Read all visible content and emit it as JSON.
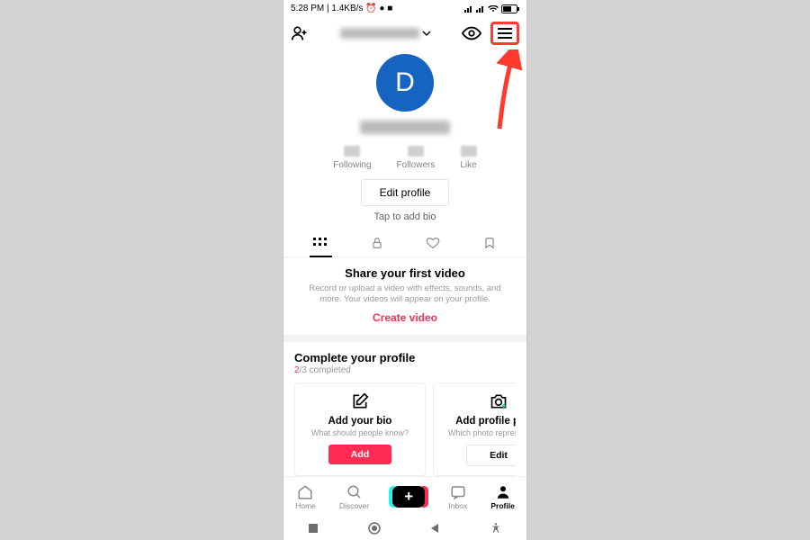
{
  "statusbar": {
    "left": "5:28 PM | 1.4KB/s ⏰ ● ■",
    "right": ""
  },
  "header": {
    "username_blurred": "████████ ████",
    "avatar_letter": "D"
  },
  "stats": [
    {
      "label": "Following"
    },
    {
      "label": "Followers"
    },
    {
      "label": "Like"
    }
  ],
  "buttons": {
    "edit_profile": "Edit profile",
    "bio_tap": "Tap to add bio"
  },
  "share": {
    "title": "Share your first video",
    "desc": "Record or upload a video with effects, sounds, and more. Your videos will appear on your profile.",
    "cta": "Create video"
  },
  "complete": {
    "title": "Complete your profile",
    "done": "2",
    "total": "3",
    "suffix": " completed",
    "cards": [
      {
        "title": "Add your bio",
        "sub": "What should people know?",
        "btn": "Add",
        "primary": true
      },
      {
        "title": "Add profile photo",
        "sub": "Which photo represents you",
        "btn": "Edit",
        "primary": false
      }
    ]
  },
  "nav": {
    "home": "Home",
    "discover": "Discover",
    "inbox": "Inbox",
    "profile": "Profile"
  }
}
